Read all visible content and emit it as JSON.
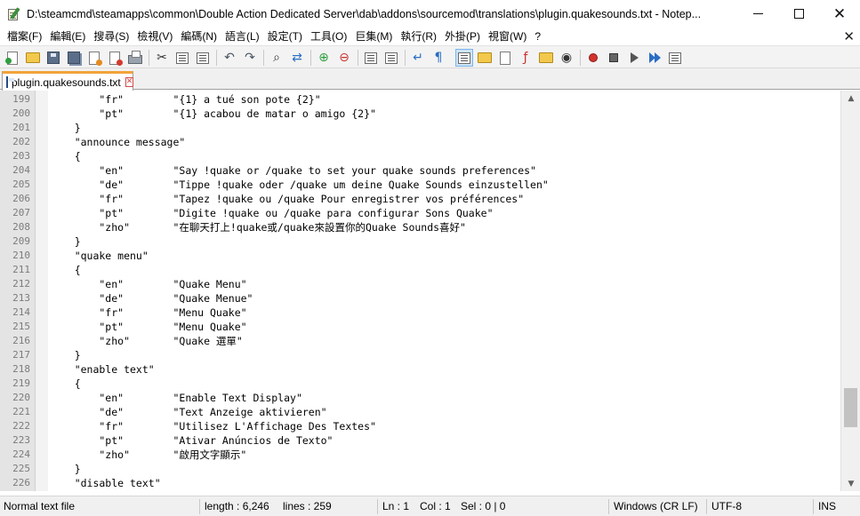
{
  "window": {
    "title": "D:\\steamcmd\\steamapps\\common\\Double Action Dedicated Server\\dab\\addons\\sourcemod\\translations\\plugin.quakesounds.txt - Notep...",
    "minimize_glyph": "",
    "close_glyph": "✕"
  },
  "menu": {
    "items": [
      "檔案(F)",
      "編輯(E)",
      "搜尋(S)",
      "檢視(V)",
      "編碼(N)",
      "語言(L)",
      "設定(T)",
      "工具(O)",
      "巨集(M)",
      "執行(R)",
      "外掛(P)",
      "視窗(W)",
      "?"
    ],
    "close_glyph": "✕"
  },
  "toolbar": {
    "icons": [
      "new-file-icon",
      "open-folder-icon",
      "save-icon",
      "save-all-icon",
      "close-icon",
      "close-all-icon",
      "print-icon",
      "cut-icon",
      "copy-icon",
      "paste-icon",
      "undo-icon",
      "redo-icon",
      "find-icon",
      "replace-icon",
      "zoom-in-icon",
      "zoom-out-icon",
      "sync-vertical-icon",
      "sync-horizontal-icon",
      "word-wrap-icon",
      "show-all-characters-icon",
      "indent-guide-icon",
      "user-defined-language-icon",
      "document-map-icon",
      "function-list-icon",
      "folder-as-workspace-icon",
      "monitoring-icon",
      "record-macro-icon",
      "stop-recording-icon",
      "playback-macro-icon",
      "run-macro-multiple-icon",
      "save-macro-icon"
    ]
  },
  "tab": {
    "label": "plugin.quakesounds.txt",
    "close_glyph": "✕"
  },
  "editor": {
    "lines": [
      {
        "n": "199",
        "text": "        \"fr\"        \"{1} a tué son pote {2}\""
      },
      {
        "n": "200",
        "text": "        \"pt\"        \"{1} acabou de matar o amigo {2}\""
      },
      {
        "n": "201",
        "text": "    }"
      },
      {
        "n": "202",
        "text": "    \"announce message\""
      },
      {
        "n": "203",
        "text": "    {"
      },
      {
        "n": "204",
        "text": "        \"en\"        \"Say !quake or /quake to set your quake sounds preferences\""
      },
      {
        "n": "205",
        "text": "        \"de\"        \"Tippe !quake oder /quake um deine Quake Sounds einzustellen\""
      },
      {
        "n": "206",
        "text": "        \"fr\"        \"Tapez !quake ou /quake Pour enregistrer vos préférences\""
      },
      {
        "n": "207",
        "text": "        \"pt\"        \"Digite !quake ou /quake para configurar Sons Quake\""
      },
      {
        "n": "208",
        "text": "        \"zho\"       \"在聊天打上!quake或/quake來設置你的Quake Sounds喜好\""
      },
      {
        "n": "209",
        "text": "    }"
      },
      {
        "n": "210",
        "text": "    \"quake menu\""
      },
      {
        "n": "211",
        "text": "    {"
      },
      {
        "n": "212",
        "text": "        \"en\"        \"Quake Menu\""
      },
      {
        "n": "213",
        "text": "        \"de\"        \"Quake Menue\""
      },
      {
        "n": "214",
        "text": "        \"fr\"        \"Menu Quake\""
      },
      {
        "n": "215",
        "text": "        \"pt\"        \"Menu Quake\""
      },
      {
        "n": "216",
        "text": "        \"zho\"       \"Quake 選單\""
      },
      {
        "n": "217",
        "text": "    }"
      },
      {
        "n": "218",
        "text": "    \"enable text\""
      },
      {
        "n": "219",
        "text": "    {"
      },
      {
        "n": "220",
        "text": "        \"en\"        \"Enable Text Display\""
      },
      {
        "n": "221",
        "text": "        \"de\"        \"Text Anzeige aktivieren\""
      },
      {
        "n": "222",
        "text": "        \"fr\"        \"Utilisez L'Affichage Des Textes\""
      },
      {
        "n": "223",
        "text": "        \"pt\"        \"Ativar Anúncios de Texto\""
      },
      {
        "n": "224",
        "text": "        \"zho\"       \"啟用文字顯示\""
      },
      {
        "n": "225",
        "text": "    }"
      },
      {
        "n": "226",
        "text": "    \"disable text\""
      }
    ]
  },
  "scrollbar": {
    "up_glyph": "▲",
    "down_glyph": "▼"
  },
  "status": {
    "file_type": "Normal text file",
    "length": "length : 6,246",
    "lines": "lines : 259",
    "ln": "Ln : 1",
    "col": "Col : 1",
    "sel": "Sel : 0 | 0",
    "eol": "Windows (CR LF)",
    "encoding": "UTF-8",
    "mode": "INS"
  }
}
